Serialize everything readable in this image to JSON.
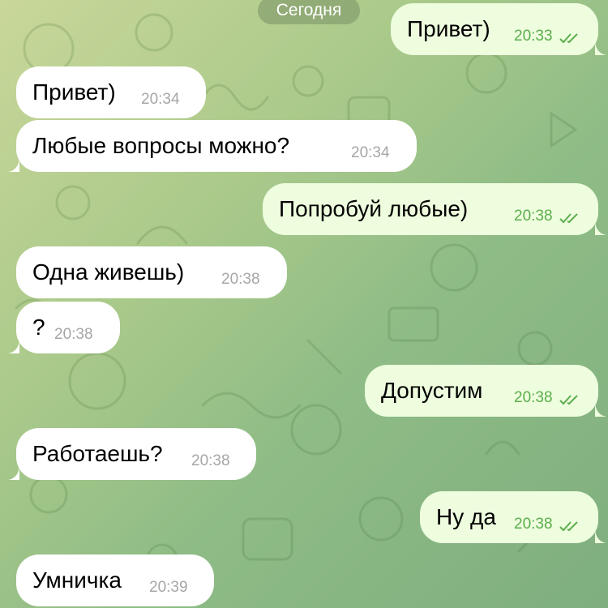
{
  "date_label": "Сегодня",
  "colors": {
    "incoming_bubble": "#ffffff",
    "outgoing_bubble": "#eefdde",
    "outgoing_time": "#5dad4e",
    "incoming_time": "#a6a6a6"
  },
  "messages": [
    {
      "direction": "out",
      "text": "Привет)",
      "time": "20:33",
      "read": true
    },
    {
      "direction": "in",
      "text": "Привет)",
      "time": "20:34"
    },
    {
      "direction": "in",
      "text": "Любые вопросы можно?",
      "time": "20:34"
    },
    {
      "direction": "out",
      "text": "Попробуй любые)",
      "time": "20:38",
      "read": true
    },
    {
      "direction": "in",
      "text": "Одна живешь)",
      "time": "20:38"
    },
    {
      "direction": "in",
      "text": "?",
      "time": "20:38"
    },
    {
      "direction": "out",
      "text": "Допустим",
      "time": "20:38",
      "read": true
    },
    {
      "direction": "in",
      "text": "Работаешь?",
      "time": "20:38"
    },
    {
      "direction": "out",
      "text": "Ну да",
      "time": "20:38",
      "read": true
    },
    {
      "direction": "in",
      "text": "Умничка",
      "time": "20:39"
    }
  ]
}
